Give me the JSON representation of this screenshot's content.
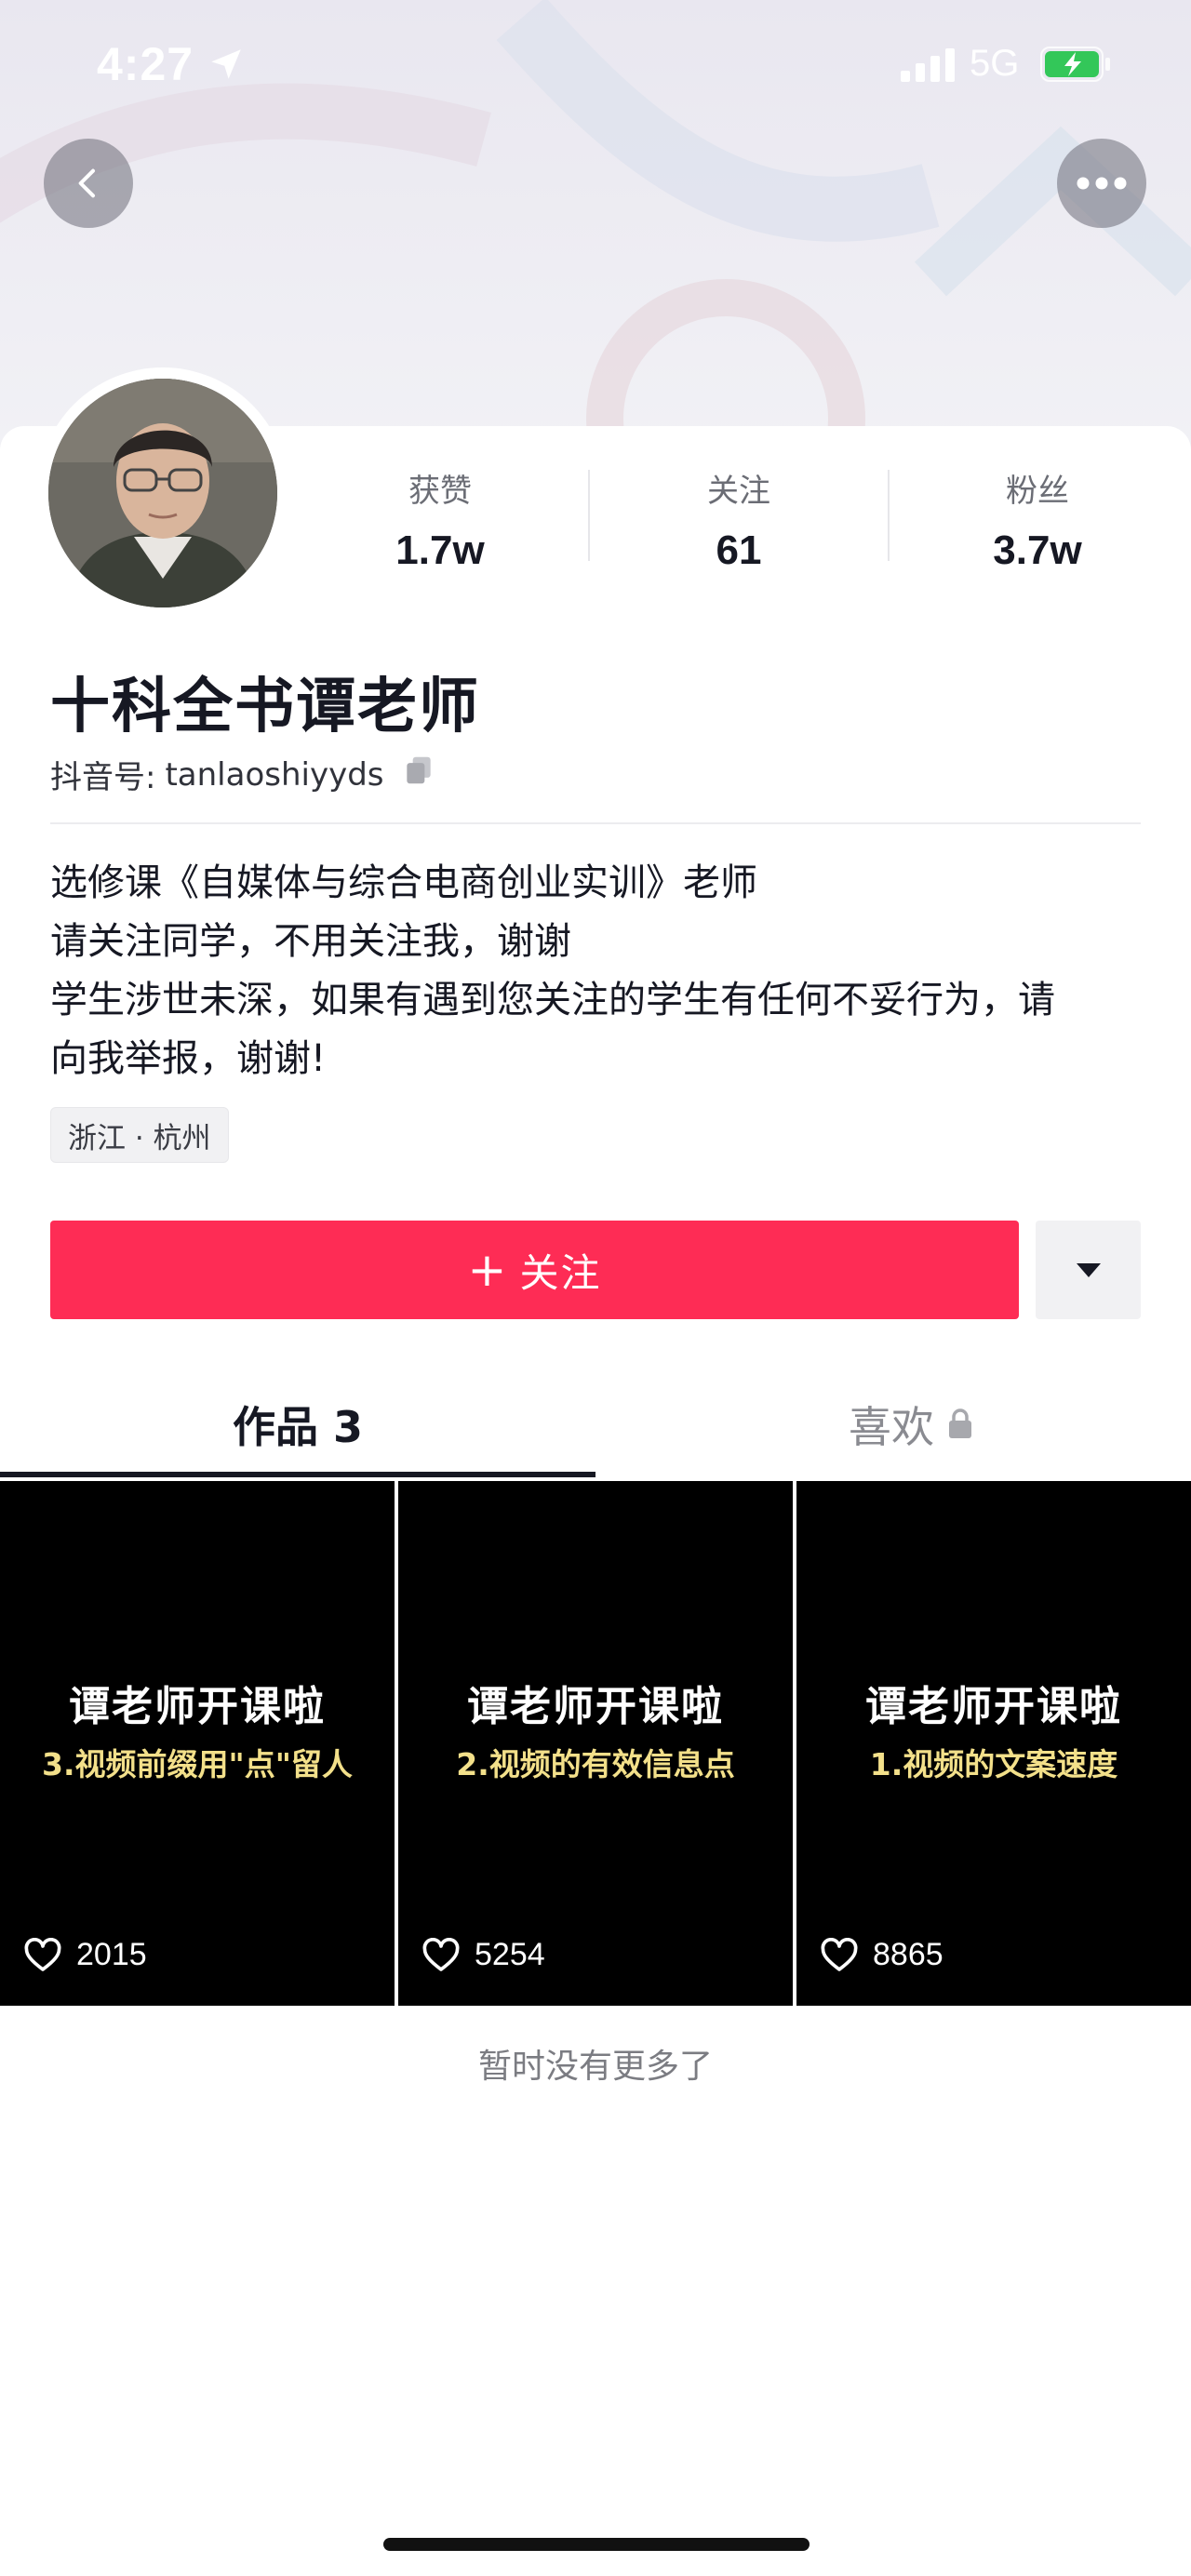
{
  "status_bar": {
    "time": "4:27",
    "network": "5G",
    "icons": [
      "location-arrow-icon",
      "signal-icon",
      "battery-charging-icon"
    ]
  },
  "nav": {
    "icons": [
      "chevron-left-icon",
      "more-icon"
    ]
  },
  "profile": {
    "stats": [
      {
        "label": "获赞",
        "value": "1.7w"
      },
      {
        "label": "关注",
        "value": "61"
      },
      {
        "label": "粉丝",
        "value": "3.7w"
      }
    ],
    "name": "十科全书谭老师",
    "handle_label": "抖音号:",
    "handle": "tanlaoshiyyds",
    "bio_lines": [
      "选修课《自媒体与综合电商创业实训》老师",
      "请关注同学，不用关注我，谢谢",
      "学生涉世未深，如果有遇到您关注的学生有任何不妥行为，请",
      "向我举报，谢谢!"
    ],
    "location_tag": "浙江 · 杭州"
  },
  "actions": {
    "follow_plus": "+",
    "follow_label": "关注",
    "accent_color": "#fe2c55"
  },
  "tabs": [
    {
      "label": "作品 3",
      "active": true
    },
    {
      "label": "喜欢",
      "active": false,
      "locked": true
    }
  ],
  "videos": [
    {
      "title": "谭老师开课啦",
      "subtitle": "3.视频前缀用\"点\"留人",
      "likes": "2015"
    },
    {
      "title": "谭老师开课啦",
      "subtitle": "2.视频的有效信息点",
      "likes": "5254"
    },
    {
      "title": "谭老师开课啦",
      "subtitle": "1.视频的文案速度",
      "likes": "8865"
    }
  ],
  "footer": {
    "no_more": "暂时没有更多了"
  }
}
